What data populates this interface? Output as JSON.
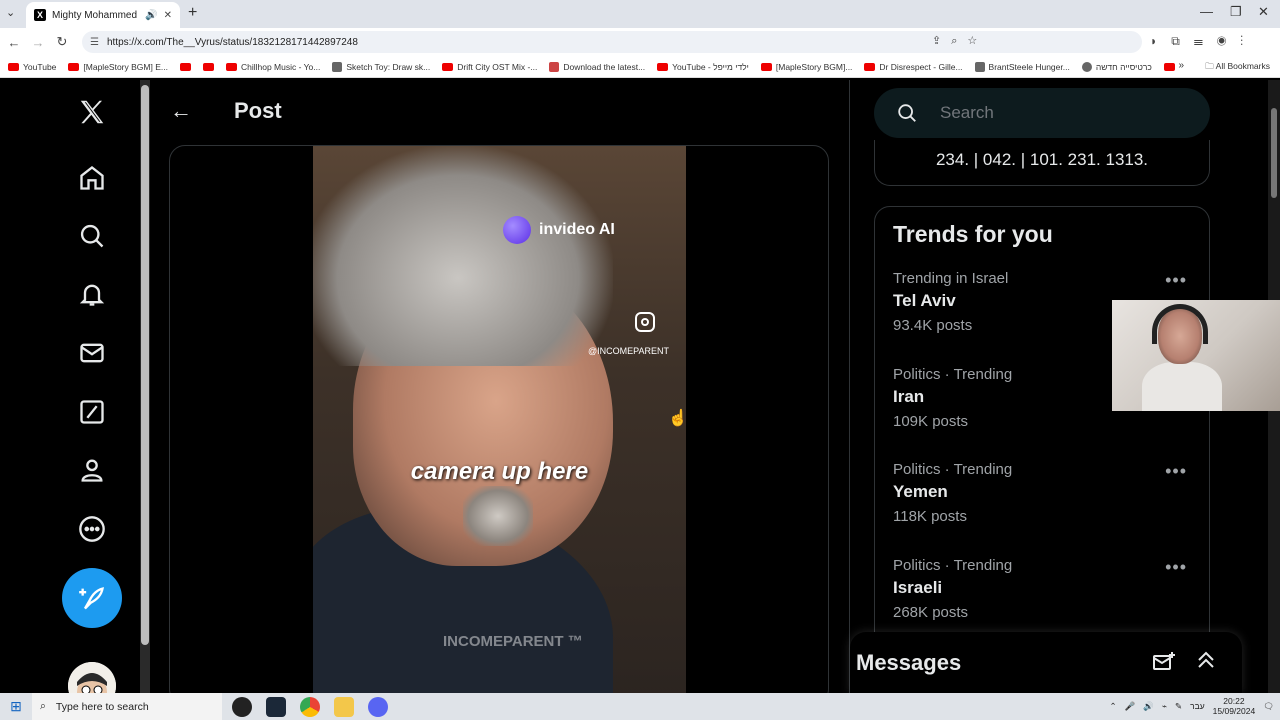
{
  "browser": {
    "tab_title": "Mighty Mohammed on X:",
    "url": "https://x.com/The__Vyrus/status/1832128171442897248",
    "bookmarks": [
      {
        "label": "YouTube",
        "icon": "youtube-icon"
      },
      {
        "label": "[MapleStory BGM] E...",
        "icon": "youtube-icon"
      },
      {
        "label": "",
        "icon": "youtube-icon"
      },
      {
        "label": "",
        "icon": "youtube-icon"
      },
      {
        "label": "Chillhop Music - Yo...",
        "icon": "youtube-icon"
      },
      {
        "label": "Sketch Toy: Draw sk...",
        "icon": "sketch-icon"
      },
      {
        "label": "Drift City OST Mix -...",
        "icon": "youtube-icon"
      },
      {
        "label": "Download the latest...",
        "icon": "download-icon"
      },
      {
        "label": "YouTube - ילדי מייפל",
        "icon": "youtube-icon"
      },
      {
        "label": "[MapleStory BGM]...",
        "icon": "youtube-icon"
      },
      {
        "label": "Dr Disrespect - Gille...",
        "icon": "youtube-icon"
      },
      {
        "label": "BrantSteele Hunger...",
        "icon": "page-icon"
      },
      {
        "label": "כרטיסייה חדשה",
        "icon": "globe-icon"
      },
      {
        "label": "",
        "icon": "youtube-icon"
      }
    ],
    "all_bookmarks": "All Bookmarks"
  },
  "post": {
    "heading": "Post",
    "video": {
      "brand": "invideo AI",
      "handle": "@INCOMEPARENT",
      "subtitle": "camera up here",
      "watermark": "INCOMEPARENT ™"
    }
  },
  "sidebar": {
    "search_placeholder": "Search",
    "phone_text": "234. | 042. | 101. 231. 1313.",
    "trends_title": "Trends for you",
    "trends": [
      {
        "context": "Trending in Israel",
        "name": "Tel Aviv",
        "count": "93.4K posts"
      },
      {
        "context": "Politics · Trending",
        "name": "Iran",
        "count": "109K posts"
      },
      {
        "context": "Politics · Trending",
        "name": "Yemen",
        "count": "118K posts"
      },
      {
        "context": "Politics · Trending",
        "name": "Israeli",
        "count": "268K posts"
      }
    ],
    "messages_title": "Messages"
  },
  "taskbar": {
    "search_placeholder": "Type here to search",
    "lang": "עבר",
    "time": "20:22",
    "date": "15/09/2024"
  },
  "colors": {
    "accent": "#1d9bf0",
    "background": "#000000",
    "text": "#e7e9ea",
    "muted": "#71767b"
  }
}
